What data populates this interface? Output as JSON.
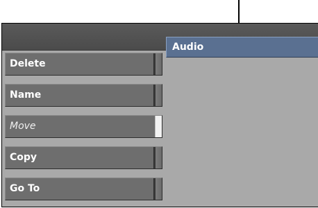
{
  "menu": {
    "buttons": [
      {
        "label": "Delete"
      },
      {
        "label": "Name"
      },
      {
        "label": "Move"
      },
      {
        "label": "Copy"
      },
      {
        "label": "Go To"
      }
    ]
  },
  "field": {
    "value": "Audio"
  },
  "colors": {
    "panel_bg": "#a9a9a9",
    "header_bg": "#555555",
    "button_bg": "#6e6e6e",
    "field_bg": "#5a7091"
  },
  "icons": {
    "annotation": "down-arrow-icon"
  }
}
